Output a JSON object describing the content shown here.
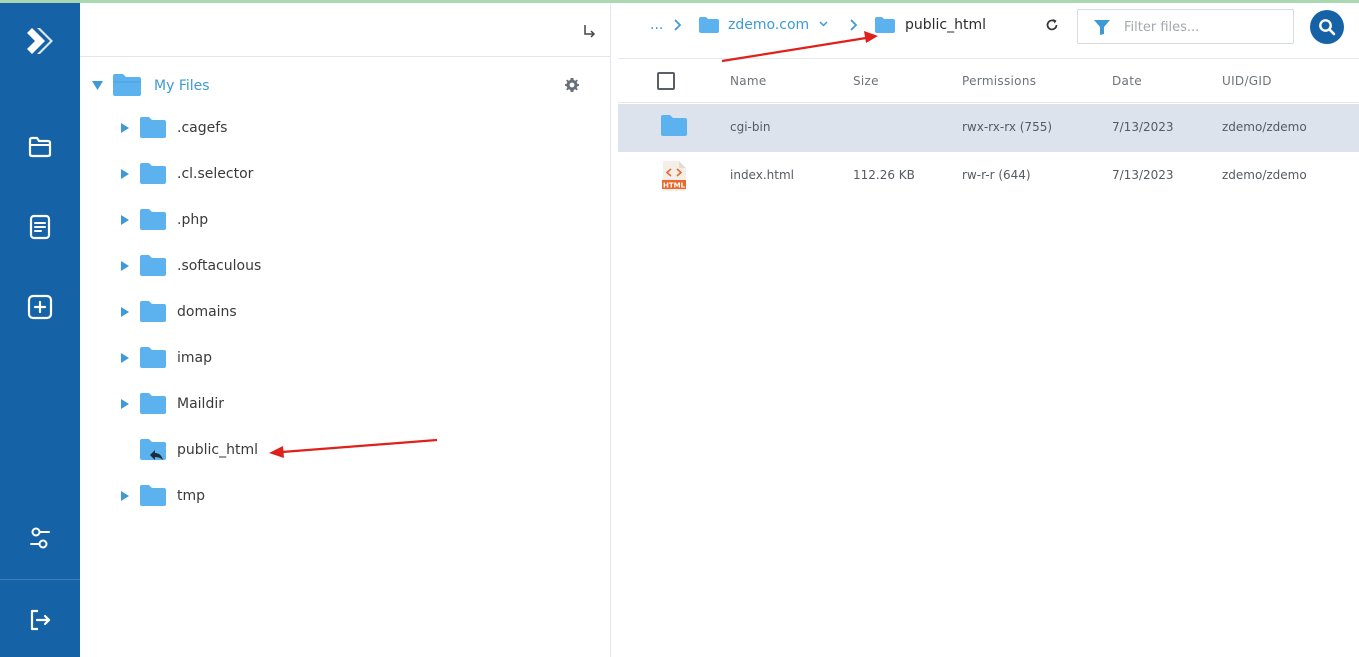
{
  "colors": {
    "rail": "#1563a6",
    "accent": "#3d9ad6",
    "folder": "#5bb2ee",
    "selected_row": "#dde3ec",
    "annotation_arrow": "#e0201a"
  },
  "nav": {
    "items": [
      {
        "name": "logo-icon"
      },
      {
        "name": "file-manager-icon"
      },
      {
        "name": "notes-icon"
      },
      {
        "name": "add-icon"
      },
      {
        "name": "settings-sliders-icon"
      },
      {
        "name": "logout-icon"
      }
    ]
  },
  "tree": {
    "root_label": "My Files",
    "items": [
      {
        "label": ".cagefs",
        "has_children": true
      },
      {
        "label": ".cl.selector",
        "has_children": true
      },
      {
        "label": ".php",
        "has_children": true
      },
      {
        "label": ".softaculous",
        "has_children": true
      },
      {
        "label": "domains",
        "has_children": true
      },
      {
        "label": "imap",
        "has_children": true
      },
      {
        "label": "Maildir",
        "has_children": true
      },
      {
        "label": "public_html",
        "has_children": false,
        "is_symlink": true
      },
      {
        "label": "tmp",
        "has_children": true
      }
    ]
  },
  "breadcrumb": {
    "ellipsis": "...",
    "domain": "zdemo.com",
    "current": "public_html"
  },
  "filter": {
    "placeholder": "Filter files..."
  },
  "table": {
    "columns": [
      "Name",
      "Size",
      "Permissions",
      "Date",
      "UID/GID"
    ],
    "rows": [
      {
        "type": "folder",
        "name": "cgi-bin",
        "size": "",
        "permissions": "rwx-rx-rx (755)",
        "date": "7/13/2023",
        "owner": "zdemo/zdemo",
        "selected": true
      },
      {
        "type": "html",
        "name": "index.html",
        "size": "112.26 KB",
        "permissions": "rw-r-r (644)",
        "date": "7/13/2023",
        "owner": "zdemo/zdemo",
        "selected": false
      }
    ],
    "html_badge": "HTML"
  }
}
